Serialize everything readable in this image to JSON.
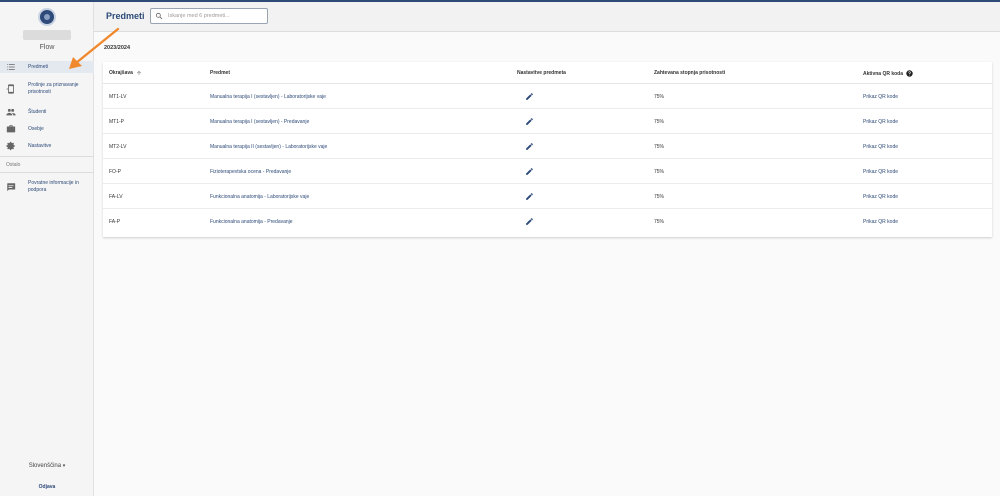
{
  "app": {
    "name": "Flow"
  },
  "sidebar": {
    "items": [
      {
        "label": "Predmeti",
        "icon": "list-icon",
        "active": true
      },
      {
        "label": "Prošnje za priznavanje prisotnosti",
        "icon": "phone-request-icon"
      },
      {
        "label": "Študenti",
        "icon": "people-icon"
      },
      {
        "label": "Osebje",
        "icon": "briefcase-icon"
      },
      {
        "label": "Nastavitve",
        "icon": "gear-icon"
      }
    ],
    "section_other": "Ostalo",
    "feedback": {
      "label": "Povratne informacije in podpora",
      "icon": "feedback-icon"
    },
    "language": "Slovenščina",
    "logout": "Odjava"
  },
  "header": {
    "title": "Predmeti",
    "search_placeholder": "Iskanje med 6 predmeti..."
  },
  "main": {
    "year": "2023/2024",
    "columns": {
      "abbr": "Okrajšava",
      "subject": "Predmet",
      "settings": "Nastavitve predmeta",
      "attendance": "Zahtevana stopnja prisotnosti",
      "qr": "Aktivna QR koda"
    },
    "rows": [
      {
        "abbr": "MT1-LV",
        "subject": "Manualna terapija I (sestavljen) - Laboratorijske vaje",
        "attendance": "75%",
        "qr": "Prikaz QR kode"
      },
      {
        "abbr": "MT1-P",
        "subject": "Manualna terapija I (sestavljen) - Predavanje",
        "attendance": "75%",
        "qr": "Prikaz QR kode"
      },
      {
        "abbr": "MT2-LV",
        "subject": "Manualna terapija II (sestavljen) - Laboratorijske vaje",
        "attendance": "75%",
        "qr": "Prikaz QR kode"
      },
      {
        "abbr": "FO-P",
        "subject": "Fizioterapevtska ocena - Predavanje",
        "attendance": "75%",
        "qr": "Prikaz QR kode"
      },
      {
        "abbr": "FA-LV",
        "subject": "Funkcionalna anatomija - Laboratorijske vaje",
        "attendance": "75%",
        "qr": "Prikaz QR kode"
      },
      {
        "abbr": "FA-P",
        "subject": "Funkcionalna anatomija - Predavanje",
        "attendance": "75%",
        "qr": "Prikaz QR kode"
      }
    ]
  },
  "colors": {
    "primary": "#2d4a78",
    "annotation_arrow": "#f0892e"
  }
}
